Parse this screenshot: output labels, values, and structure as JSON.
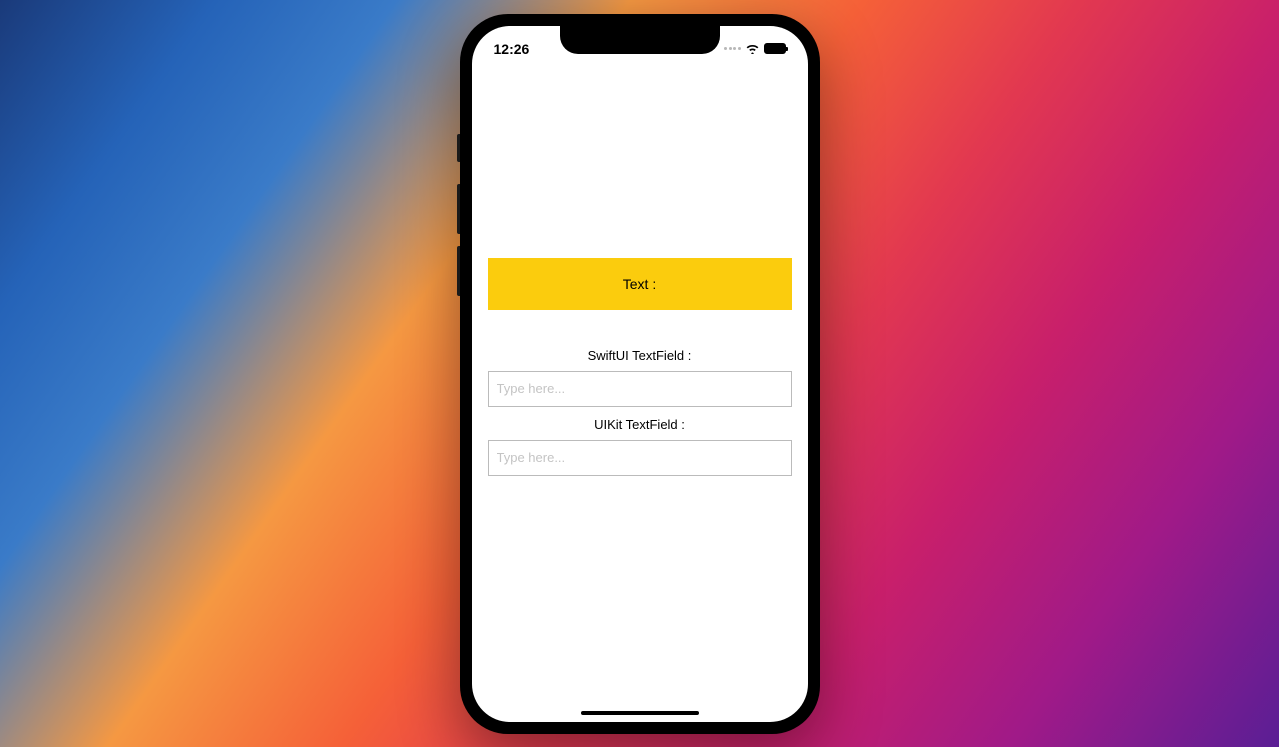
{
  "status_bar": {
    "time": "12:26"
  },
  "banner": {
    "text": "Text :"
  },
  "swiftui_field": {
    "label": "SwiftUI TextField :",
    "placeholder": "Type here...",
    "value": ""
  },
  "uikit_field": {
    "label": "UIKit TextField :",
    "placeholder": "Type here...",
    "value": ""
  }
}
